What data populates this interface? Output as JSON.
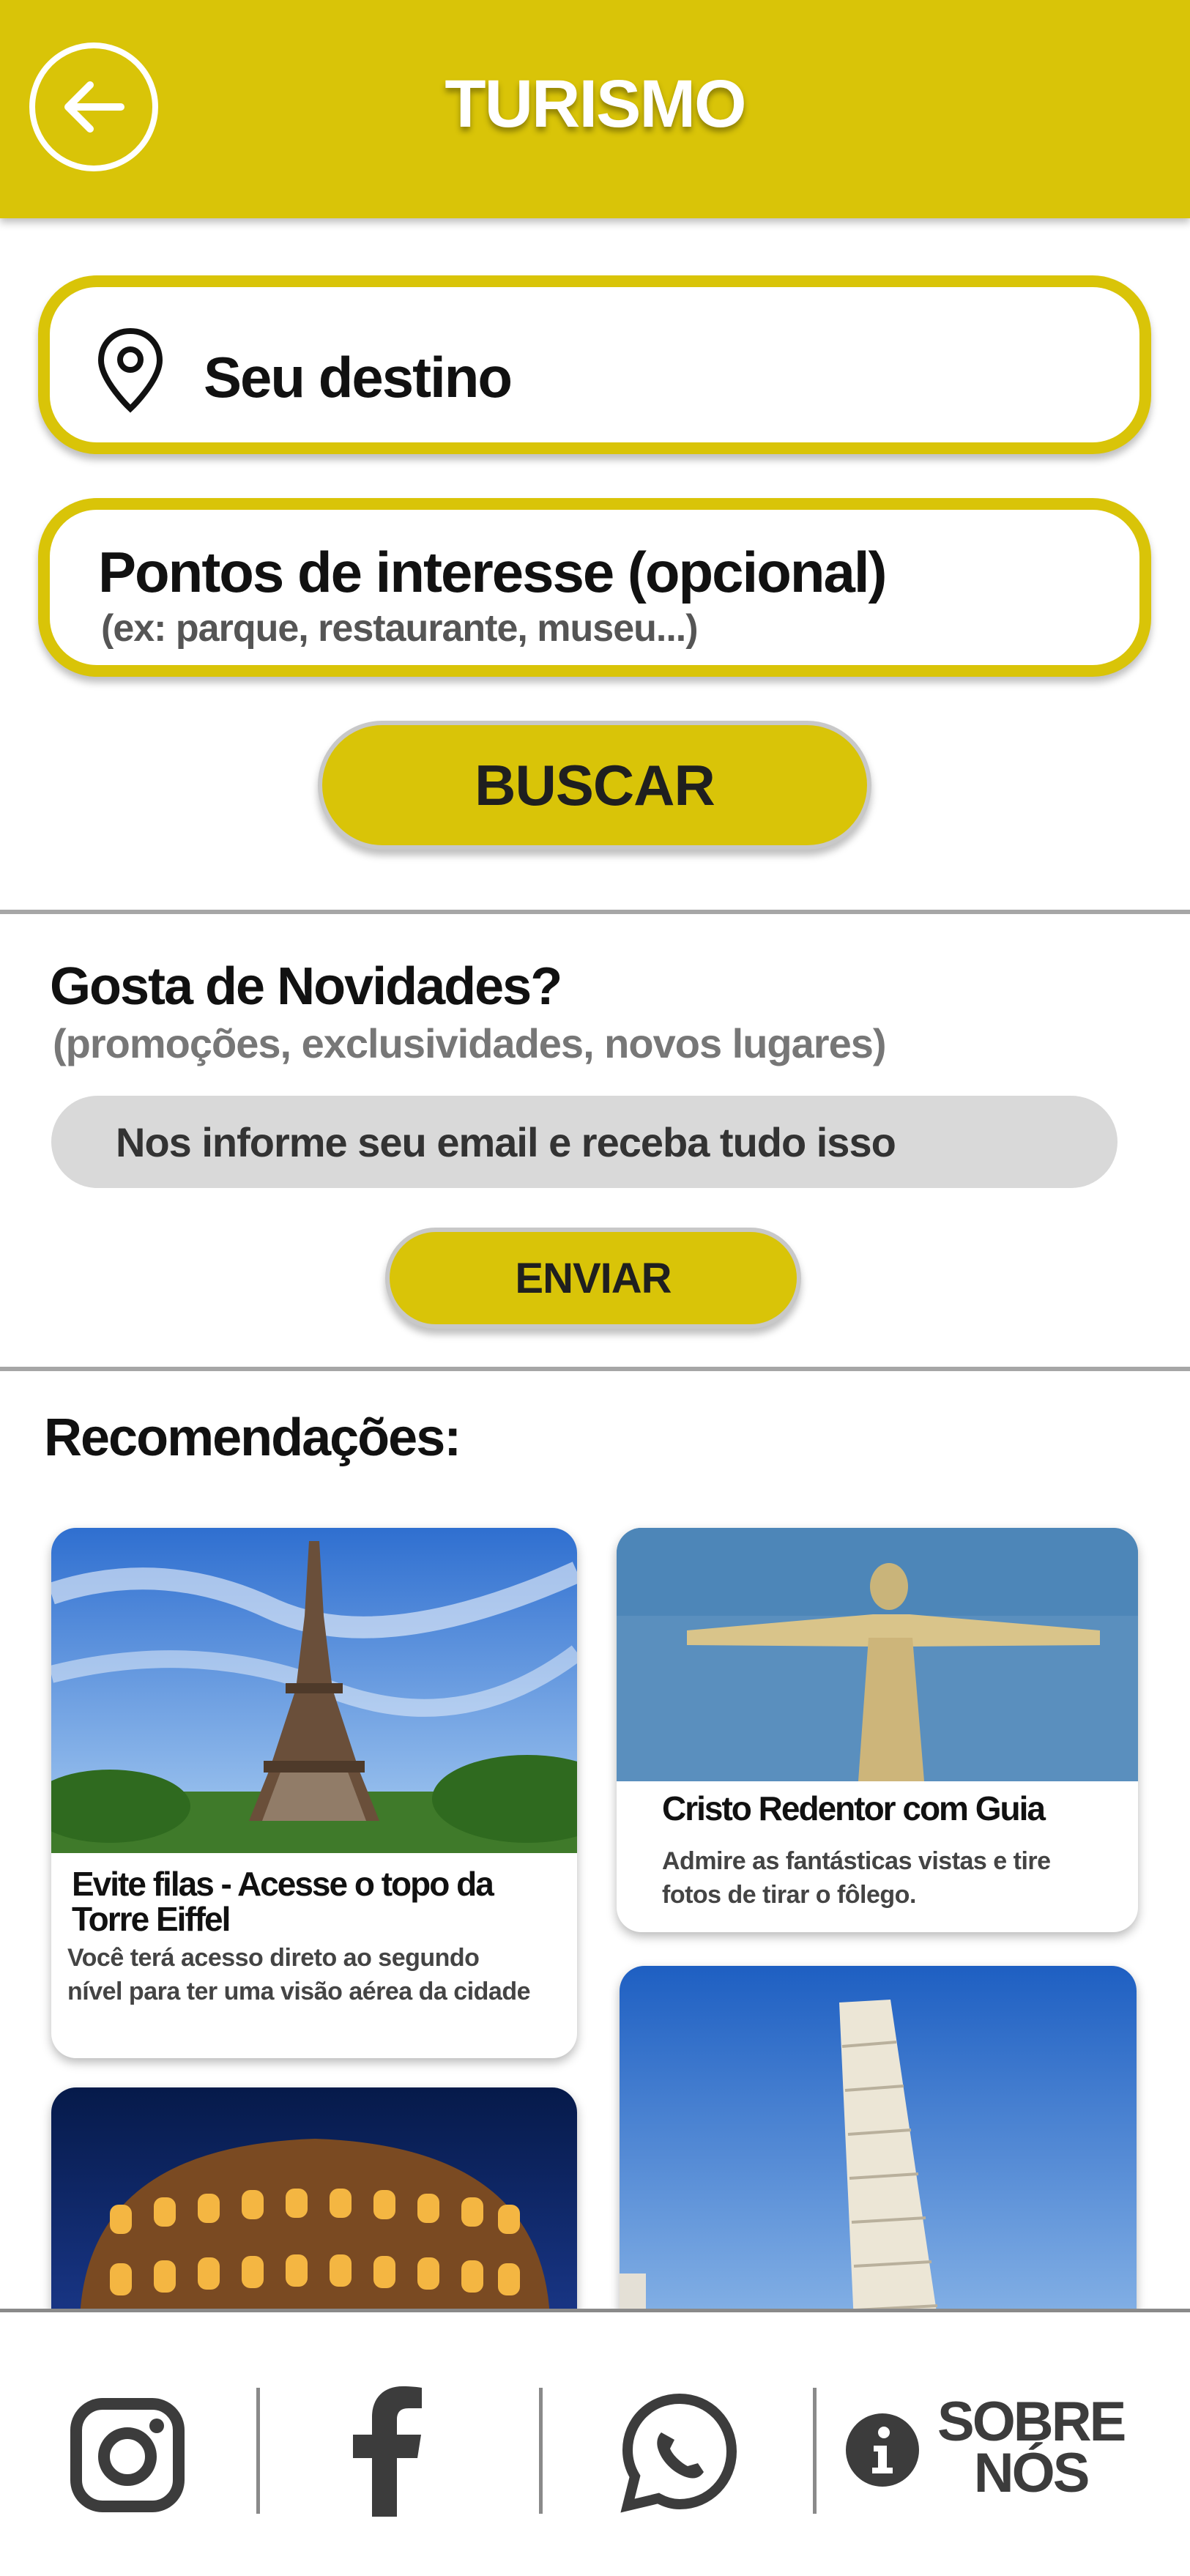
{
  "header": {
    "title": "TURISMO",
    "back_icon": "arrow-left-icon"
  },
  "search": {
    "destination_placeholder": "Seu destino",
    "poi_placeholder": "Pontos de interesse (opcional)",
    "poi_hint": "(ex: parque, restaurante, museu...)",
    "button_label": "BUSCAR"
  },
  "newsletter": {
    "title": "Gosta de Novidades?",
    "subtitle": "(promoções, exclusividades, novos lugares)",
    "email_placeholder": "Nos informe seu email e receba tudo isso",
    "button_label": "ENVIAR"
  },
  "recommendations": {
    "title": "Recomendações:",
    "cards": [
      {
        "title": "Evite filas - Acesse o topo da Torre Eiffel",
        "description": "Você terá acesso direto ao segundo nível para ter uma visão aérea da cidade",
        "image": "eiffel-tower"
      },
      {
        "title": "Cristo Redentor com Guia",
        "description": "Admire as fantásticas vistas e tire fotos de tirar o fôlego.",
        "image": "christ-the-redeemer"
      },
      {
        "title": "",
        "description": "",
        "image": "colosseum"
      },
      {
        "title": "",
        "description": "",
        "image": "leaning-tower-of-pisa"
      }
    ]
  },
  "bottom_nav": {
    "items": [
      {
        "icon": "instagram-icon"
      },
      {
        "icon": "facebook-icon"
      },
      {
        "icon": "whatsapp-icon"
      },
      {
        "icon": "info-icon",
        "label_line1": "SOBRE",
        "label_line2": "NÓS"
      }
    ]
  },
  "colors": {
    "brand_yellow": "#D9C408",
    "divider": "#A6A6A6",
    "input_gray": "#D9D9D9"
  }
}
